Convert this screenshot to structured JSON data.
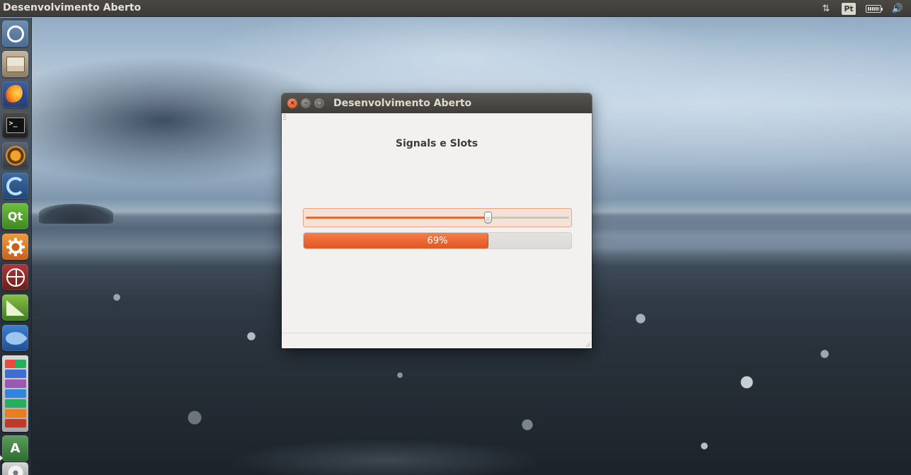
{
  "top_panel": {
    "app_title": "Desenvolvimento Aberto",
    "keyboard_layout": "Pt",
    "icons": [
      "network-updown-icon",
      "keyboard-layout-indicator",
      "battery-icon",
      "volume-icon"
    ]
  },
  "launcher": {
    "items": [
      {
        "name": "ubuntu-dash-icon"
      },
      {
        "name": "files-icon"
      },
      {
        "name": "firefox-icon"
      },
      {
        "name": "terminal-icon",
        "glyph": ">_"
      },
      {
        "name": "lazarus-ide-icon"
      },
      {
        "name": "swirl-app-icon"
      },
      {
        "name": "qt-creator-icon",
        "glyph": "Qt"
      },
      {
        "name": "system-settings-icon"
      },
      {
        "name": "web-browser-icon"
      },
      {
        "name": "libreoffice-calc-icon"
      },
      {
        "name": "fish-app-icon"
      },
      {
        "name": "stacked-apps-icon"
      },
      {
        "name": "software-installer-icon",
        "glyph": "A"
      },
      {
        "name": "dvd-drive-icon"
      }
    ]
  },
  "window": {
    "title": "Desenvolvimento Aberto",
    "heading": "Signals e Slots",
    "slider": {
      "value": 69,
      "min": 0,
      "max": 100
    },
    "progress": {
      "value": 69,
      "text": "69%"
    }
  },
  "colors": {
    "accent": "#e9652f",
    "panel": "#3c3b37",
    "window_bg": "#f2f1f0"
  }
}
